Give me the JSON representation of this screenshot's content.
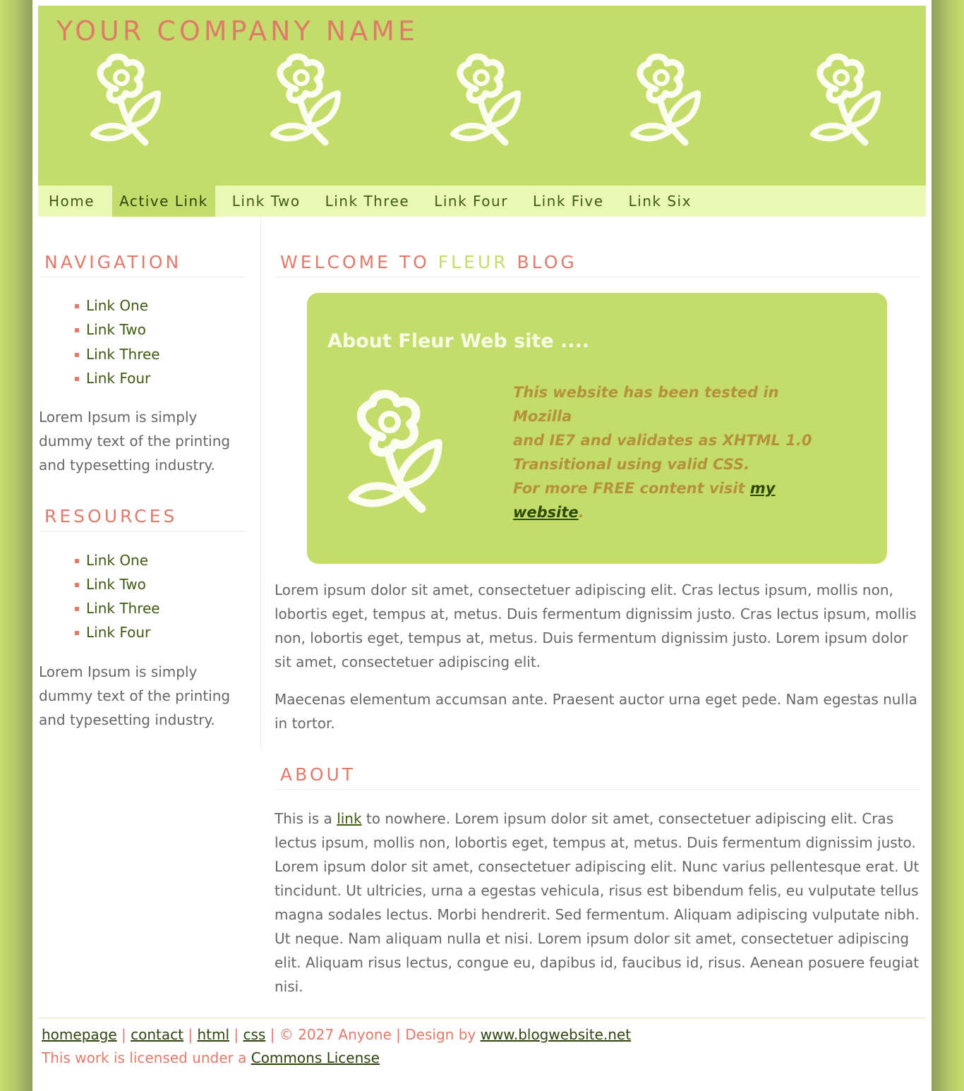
{
  "header": {
    "company_name": "YOUR COMPANY NAME"
  },
  "nav": {
    "items": [
      {
        "label": "Home"
      },
      {
        "label": "Active Link"
      },
      {
        "label": "Link Two"
      },
      {
        "label": "Link Three"
      },
      {
        "label": "Link Four"
      },
      {
        "label": "Link Five"
      },
      {
        "label": "Link Six"
      }
    ],
    "active_index": 1
  },
  "sidebar": {
    "navigation": {
      "heading": "NAVIGATION",
      "links": [
        "Link One",
        "Link Two",
        "Link Three",
        "Link Four"
      ],
      "text": "Lorem Ipsum is simply dummy text of the printing and typesetting industry."
    },
    "resources": {
      "heading": "RESOURCES",
      "links": [
        "Link One",
        "Link Two",
        "Link Three",
        "Link Four"
      ],
      "text": "Lorem Ipsum is simply dummy text of the printing and typesetting industry."
    }
  },
  "main": {
    "welcome": {
      "prefix": "WELCOME TO",
      "highlight": "FLEUR",
      "suffix": "BLOG"
    },
    "box": {
      "title": "About Fleur Web site ....",
      "note_lines": [
        "This website has been tested in Mozilla",
        "and IE7 and validates as XHTML 1.0",
        "Transitional using valid CSS."
      ],
      "note_more": "For more FREE content visit",
      "note_link": "my website",
      "note_end": "."
    },
    "paragraph1": "Lorem ipsum dolor sit amet, consectetuer adipiscing elit. Cras lectus ipsum, mollis non, lobortis eget, tempus at, metus. Duis fermentum dignissim justo. Cras lectus ipsum, mollis non, lobortis eget, tempus at, metus. Duis fermentum dignissim justo. Lorem ipsum dolor sit amet, consectetuer adipiscing elit.",
    "paragraph2": "Maecenas elementum accumsan ante. Praesent auctor urna eget pede. Nam egestas nulla in tortor.",
    "about": {
      "heading": "ABOUT",
      "prefix": "This is a",
      "link": "link",
      "rest": "to nowhere. Lorem ipsum dolor sit amet, consectetuer adipiscing elit. Cras lectus ipsum, mollis non, lobortis eget, tempus at, metus. Duis fermentum dignissim justo. Lorem ipsum dolor sit amet, consectetuer adipiscing elit. Nunc varius pellentesque erat. Ut tincidunt. Ut ultricies, urna a egestas vehicula, risus est bibendum felis, eu vulputate tellus magna sodales lectus. Morbi hendrerit. Sed fermentum. Aliquam adipiscing vulputate nibh. Ut neque. Nam aliquam nulla et nisi. Lorem ipsum dolor sit amet, consectetuer adipiscing elit. Aliquam risus lectus, congue eu, dapibus id, faucibus id, risus. Aenean posuere feugiat nisi."
    }
  },
  "footer": {
    "links": [
      "homepage",
      "contact",
      "html",
      "css"
    ],
    "separator": "|",
    "copyright": "© 2027 Anyone",
    "design_by": "Design by",
    "design_link": "www.blogwebsite.net",
    "license_text": "This work is licensed under a",
    "license_link": "Commons License"
  },
  "colors": {
    "accent_green": "#c4dc69",
    "nav_bg": "#eaf8b5",
    "heading_coral": "#e07a6b",
    "link_dark_green": "#3f5a12"
  }
}
